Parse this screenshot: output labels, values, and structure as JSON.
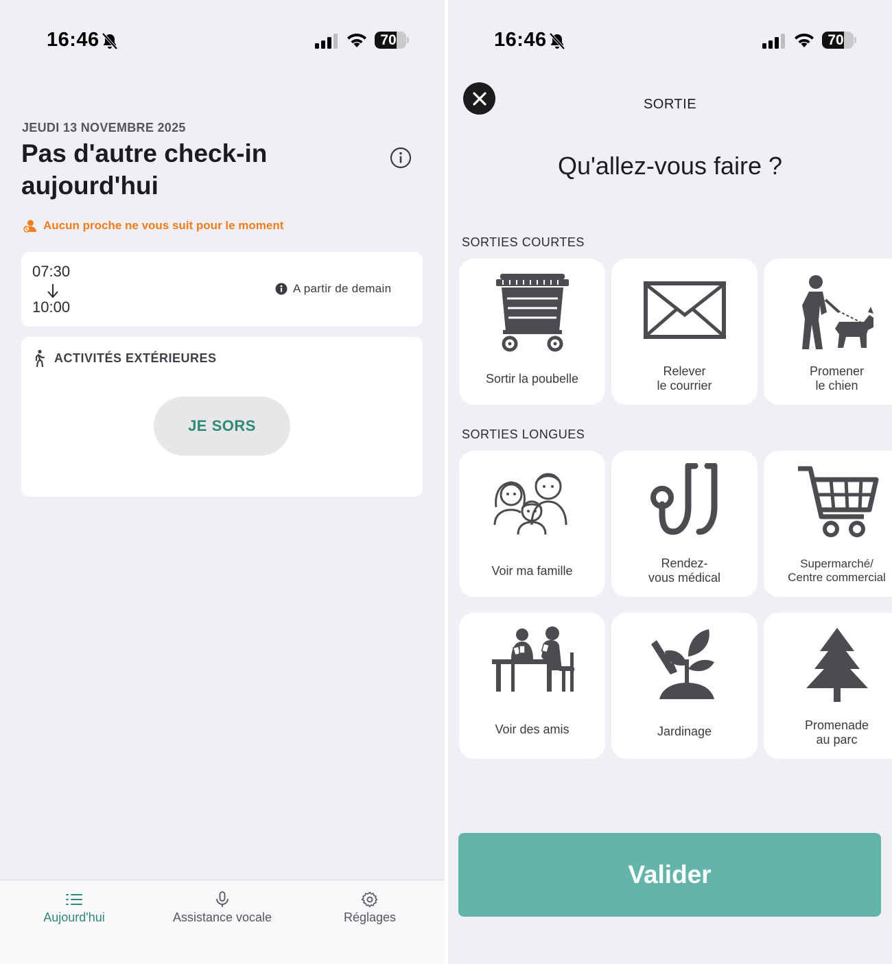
{
  "status_bar": {
    "time": "16:46",
    "battery": "70",
    "battery_level_percent": 70
  },
  "today_screen": {
    "date": "JEUDI 13 NOVEMBRE 2025",
    "title": "Pas d'autre check-in aujourd'hui",
    "follow_notice": "Aucun proche ne vous suit pour le moment",
    "time_window": {
      "start": "07:30",
      "end": "10:00",
      "note": "A partir de demain"
    },
    "activities": {
      "header": "ACTIVITÉS EXTÉRIEURES",
      "button": "JE SORS"
    },
    "tabs": [
      {
        "label": "Aujourd'hui",
        "icon": "list-icon",
        "active": true
      },
      {
        "label": "Assistance vocale",
        "icon": "microphone-icon",
        "active": false
      },
      {
        "label": "Réglages",
        "icon": "gear-icon",
        "active": false
      }
    ]
  },
  "outing_screen": {
    "title": "SORTIE",
    "question": "Qu'allez-vous faire ?",
    "short_section": "SORTIES COURTES",
    "long_section": "SORTIES LONGUES",
    "short_tiles": [
      {
        "label": "Sortir la poubelle",
        "icon": "trash-bin-icon"
      },
      {
        "label_line1": "Relever",
        "label_line2": "le courrier",
        "icon": "envelope-icon"
      },
      {
        "label_line1": "Promener",
        "label_line2": "le chien",
        "icon": "dog-walk-icon"
      }
    ],
    "long_tiles": [
      {
        "label": "Voir ma famille",
        "icon": "family-icon"
      },
      {
        "label_line1": "Rendez-",
        "label_line2": "vous médical",
        "icon": "stethoscope-icon"
      },
      {
        "label_line1": "Supermarché/",
        "label_line2": "Centre commercial",
        "icon": "shopping-cart-icon"
      },
      {
        "label": "Voir des amis",
        "icon": "friends-cards-icon"
      },
      {
        "label": "Jardinage",
        "icon": "gardening-icon"
      },
      {
        "label_line1": "Promenade",
        "label_line2": "au parc",
        "icon": "tree-icon"
      }
    ],
    "submit": "Valider"
  },
  "colors": {
    "accent_green": "#2f8a75",
    "button_teal": "#63b5aa",
    "warning_orange": "#ef7d1c",
    "icon_gray": "#4b4b50"
  }
}
